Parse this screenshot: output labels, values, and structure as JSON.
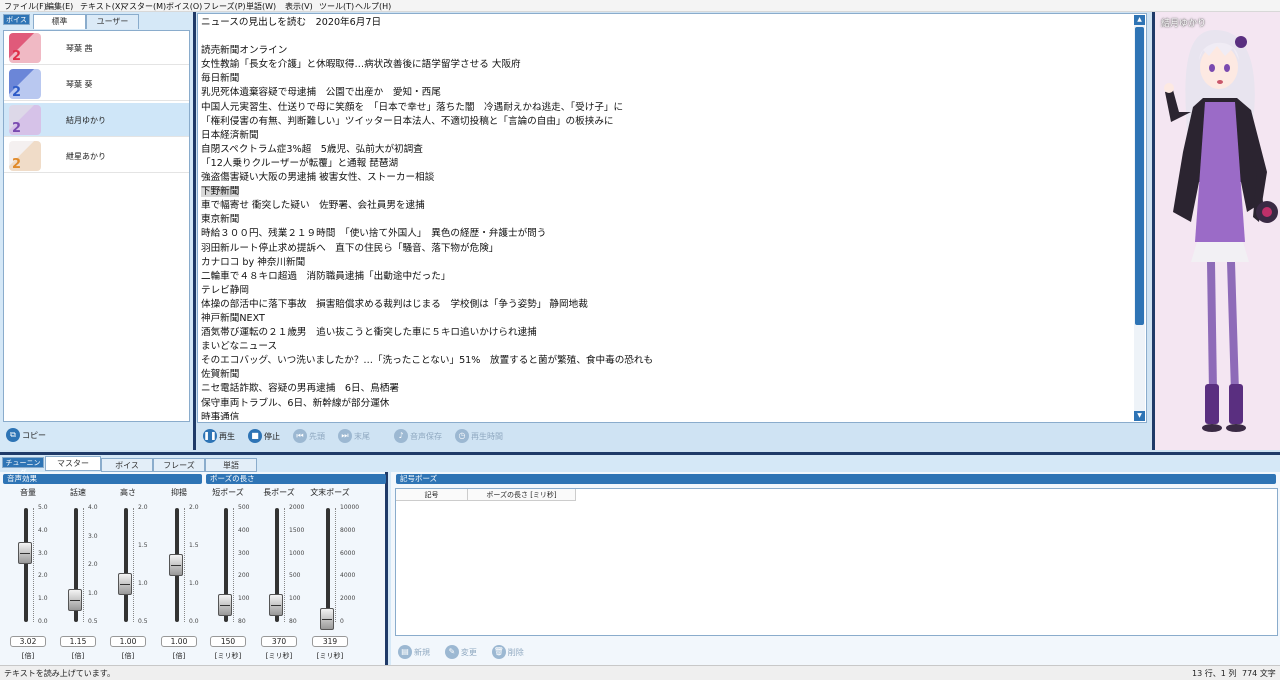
{
  "menu": [
    "ファイル(F)",
    "編集(E)",
    "テキスト(X)",
    "マスター(M)",
    "ボイス(O)",
    "フレーズ(P)",
    "単語(W)",
    "表示(V)",
    "ツール(T)",
    "ヘルプ(H)"
  ],
  "voice_panel": {
    "label": "ボイス",
    "tabs": [
      "標準",
      "ユーザー"
    ],
    "voices": [
      {
        "name": "琴葉 茜",
        "num": "2",
        "num_color": "#e0304a"
      },
      {
        "name": "琴葉 葵",
        "num": "2",
        "num_color": "#2e5cc8"
      },
      {
        "name": "結月ゆかり",
        "num": "2",
        "num_color": "#7a4ab0"
      },
      {
        "name": "紲星あかり",
        "num": "2",
        "num_color": "#e08a2a"
      }
    ],
    "copy_label": "コピー"
  },
  "editor": {
    "lines": [
      "ニュースの見出しを読む　2020年6月7日",
      "",
      "読売新聞オンライン",
      "女性教諭「長女を介護」と休暇取得…病状改善後に語学留学させる 大阪府",
      "毎日新聞",
      "乳児死体遺棄容疑で母逮捕　公園で出産か　愛知・西尾",
      "中国人元実習生、仕送りで母に笑顔を　「日本で幸せ」落ちた闇　冷遇耐えかね逃走、「受け子」に",
      "「権利侵害の有無、判断難しい」ツイッター日本法人、不適切投稿と「言論の自由」の板挟みに",
      "日本経済新聞",
      "自閉スペクトラム症3%超　5歳児、弘前大が初調査",
      "「12人乗りクルーザーが転覆」と通報 琵琶湖",
      "強盗傷害疑い大阪の男逮捕 被害女性、ストーカー相談",
      "下野新聞",
      "車で幅寄せ 衝突した疑い　佐野署、会社員男を逮捕",
      "東京新聞",
      "時給３００円、残業２１９時間　「使い捨て外国人」　異色の経歴・弁護士が問う",
      "羽田新ルート停止求め提訴へ　直下の住民ら「騒音、落下物が危険」",
      "カナロコ by 神奈川新聞",
      "二輪車で４８キロ超過　消防職員逮捕「出動途中だった」",
      "テレビ静岡",
      "体操の部活中に落下事故　損害賠償求める裁判はじまる　学校側は「争う姿勢」 静岡地裁",
      "神戸新聞NEXT",
      "酒気帯び運転の２１歳男　追い抜こうと衝突した車に５キロ追いかけられ逮捕",
      "まいどなニュース",
      "そのエコバッグ、いつ洗いましたか？…「洗ったことない」51%　放置すると菌が繁殖、食中毒の恐れも",
      "佐賀新聞",
      "ニセ電話詐欺、容疑の男再逮捕　6日、鳥栖署",
      "保守車両トラブル、6日、新幹線が部分運休",
      "時事通信"
    ],
    "highlight_line": 12
  },
  "player": {
    "play": "再生",
    "stop": "停止",
    "head": "先頭",
    "tail": "末尾",
    "save": "音声保存",
    "time": "再生時間"
  },
  "character": {
    "name": "結月ゆかり"
  },
  "tuning": {
    "tabs": [
      "チューニング",
      "マスター",
      "ボイス",
      "フレーズ",
      "単語"
    ],
    "active_tab": "マスター",
    "voice_effect_title": "音声効果",
    "pause_len_title": "ポーズの長さ",
    "symbol_pause_title": "記号ポーズ",
    "sliders": [
      {
        "label": "音量",
        "value": "3.02",
        "unit": "[倍]",
        "ticks": [
          "5.0",
          "4.0",
          "3.0",
          "2.0",
          "1.0",
          "0.0"
        ],
        "level": 0.604
      },
      {
        "label": "話速",
        "value": "1.15",
        "unit": "[倍]",
        "ticks": [
          "4.0",
          "3.0",
          "2.0",
          "1.0",
          "0.5"
        ],
        "level": 0.19
      },
      {
        "label": "高さ",
        "value": "1.00",
        "unit": "[倍]",
        "ticks": [
          "2.0",
          "1.5",
          "1.0",
          "0.5"
        ],
        "level": 0.33
      },
      {
        "label": "抑揚",
        "value": "1.00",
        "unit": "[倍]",
        "ticks": [
          "2.0",
          "1.5",
          "1.0",
          "0.0"
        ],
        "level": 0.5
      },
      {
        "label": "短ポーズ",
        "value": "150",
        "unit": "[ミリ秒]",
        "ticks": [
          "500",
          "400",
          "300",
          "200",
          "100",
          "80"
        ],
        "level": 0.15
      },
      {
        "label": "長ポーズ",
        "value": "370",
        "unit": "[ミリ秒]",
        "ticks": [
          "2000",
          "1500",
          "1000",
          "500",
          "100",
          "80"
        ],
        "level": 0.15
      },
      {
        "label": "文末ポーズ",
        "value": "319",
        "unit": "[ミリ秒]",
        "ticks": [
          "10000",
          "8000",
          "6000",
          "4000",
          "2000",
          "0"
        ],
        "level": 0.03
      }
    ],
    "pause_table": {
      "headers": [
        "記号",
        "ポーズの長さ [ミリ秒]"
      ]
    },
    "pause_buttons": [
      "新規",
      "変更",
      "削除"
    ]
  },
  "status": {
    "message": "テキストを読み上げています。",
    "position": "13 行、1 列",
    "chars": "774 文字"
  }
}
